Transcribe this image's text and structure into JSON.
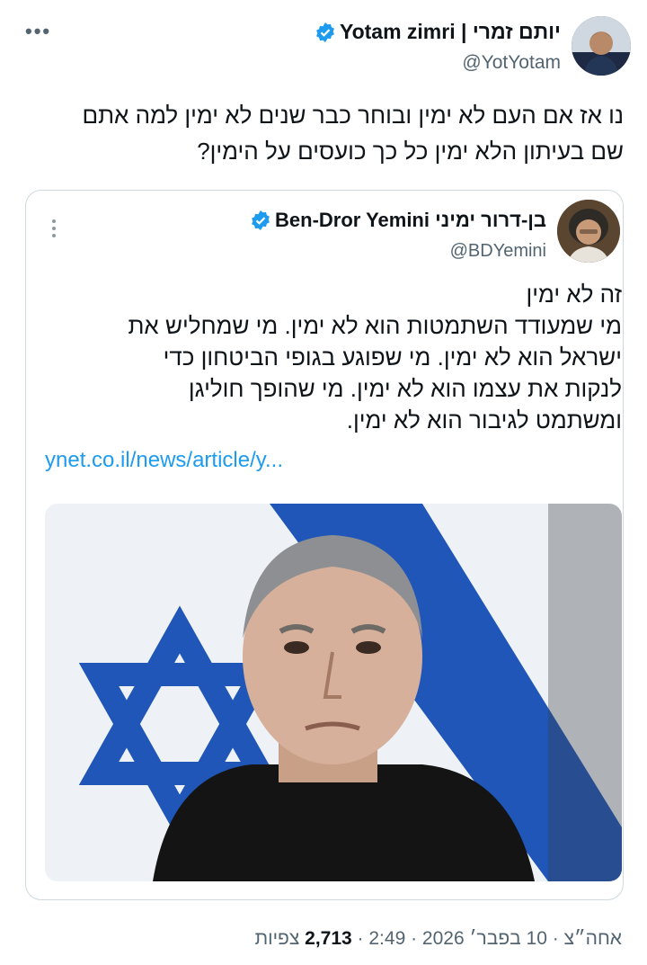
{
  "tweet": {
    "author_name": "Yotam zimri | יותם זמרי",
    "handle": "@YotYotam",
    "text_lines": [
      "נו אז אם העם לא ימין ובוחר כבר שנים לא ימין למה אתם",
      "שם בעיתון הלא ימין כל כך כועסים על הימין?"
    ]
  },
  "quoted": {
    "author_name": "Ben-Dror Yemini בן-דרור ימיני",
    "handle": "@BDYemini",
    "text_lines": [
      "זה לא ימין",
      "מי שמעודד השתמטות הוא לא ימין. מי שמחליש את",
      "ישראל הוא לא ימין. מי שפוגע בגופי הביטחון כדי",
      "לנקות את עצמו הוא לא ימין. מי שהופך חוליגן",
      "ומשתמט לגיבור הוא לא ימין."
    ],
    "link": "ynet.co.il/news/article/y..."
  },
  "footer": {
    "time": "אחה״צ · 10 בפבר׳ 2026 · 2:49",
    "views_count": "2,713",
    "views_label": "צפיות"
  },
  "colors": {
    "accent": "#1d9bf0",
    "muted": "#536471",
    "border": "#cfd9de"
  },
  "icons": [
    "more-horizontal-icon",
    "verified-badge-icon",
    "more-vertical-icon"
  ]
}
